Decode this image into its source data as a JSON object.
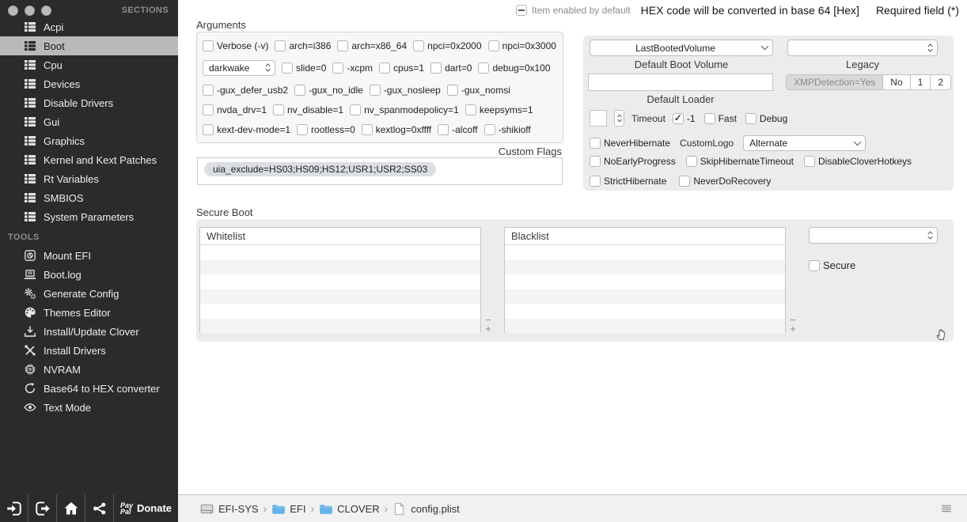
{
  "header": {
    "item_enabled_label": "Item enabled by default",
    "hex_note": "HEX code will be converted in base 64 [Hex]",
    "required_note": "Required field (*)"
  },
  "sidebar": {
    "sections_title": "SECTIONS",
    "tools_title": "TOOLS",
    "sections": [
      {
        "label": "Acpi"
      },
      {
        "label": "Boot",
        "selected": true
      },
      {
        "label": "Cpu"
      },
      {
        "label": "Devices"
      },
      {
        "label": "Disable Drivers"
      },
      {
        "label": "Gui"
      },
      {
        "label": "Graphics"
      },
      {
        "label": "Kernel and Kext Patches"
      },
      {
        "label": "Rt Variables"
      },
      {
        "label": "SMBIOS"
      },
      {
        "label": "System Parameters"
      }
    ],
    "tools": [
      {
        "label": "Mount EFI",
        "icon": "mount-efi-icon"
      },
      {
        "label": "Boot.log",
        "icon": "bootlog-icon"
      },
      {
        "label": "Generate Config",
        "icon": "gears-icon"
      },
      {
        "label": "Themes Editor",
        "icon": "palette-icon"
      },
      {
        "label": "Install/Update Clover",
        "icon": "download-icon"
      },
      {
        "label": "Install Drivers",
        "icon": "tools-icon"
      },
      {
        "label": "NVRAM",
        "icon": "chip-icon"
      },
      {
        "label": "Base64 to HEX converter",
        "icon": "refresh-icon"
      },
      {
        "label": "Text Mode",
        "icon": "eye-icon"
      }
    ]
  },
  "arguments": {
    "title": "Arguments",
    "rows": [
      [
        {
          "t": "check",
          "label": "Verbose (-v)"
        },
        {
          "t": "check",
          "label": "arch=i386"
        },
        {
          "t": "check",
          "label": "arch=x86_64"
        },
        {
          "t": "check",
          "label": "npci=0x2000"
        },
        {
          "t": "check",
          "label": "npci=0x3000"
        }
      ],
      [
        {
          "t": "popup",
          "value": "darkwake"
        },
        {
          "t": "check",
          "label": "slide=0"
        },
        {
          "t": "check",
          "label": "-xcpm"
        },
        {
          "t": "check",
          "label": "cpus=1"
        },
        {
          "t": "check",
          "label": "dart=0"
        },
        {
          "t": "check",
          "label": "debug=0x100"
        }
      ],
      [
        {
          "t": "check",
          "label": "-gux_defer_usb2"
        },
        {
          "t": "check",
          "label": "-gux_no_idle"
        },
        {
          "t": "check",
          "label": "-gux_nosleep"
        },
        {
          "t": "check",
          "label": "-gux_nomsi"
        }
      ],
      [
        {
          "t": "check",
          "label": "nvda_drv=1"
        },
        {
          "t": "check",
          "label": "nv_disable=1"
        },
        {
          "t": "check",
          "label": "nv_spanmodepolicy=1"
        },
        {
          "t": "check",
          "label": "keepsyms=1"
        }
      ],
      [
        {
          "t": "check",
          "label": "kext-dev-mode=1"
        },
        {
          "t": "check",
          "label": "rootless=0"
        },
        {
          "t": "check",
          "label": "kextlog=0xffff"
        },
        {
          "t": "check",
          "label": "-alcoff"
        },
        {
          "t": "check",
          "label": "-shikioff"
        }
      ]
    ],
    "custom_flags_label": "Custom Flags",
    "custom_flags_token": "uia_exclude=HS03;HS09;HS12;USR1;USR2;SS03"
  },
  "boot": {
    "default_boot_volume_value": "LastBootedVolume",
    "default_boot_volume_label": "Default Boot Volume",
    "legacy_value": "",
    "legacy_label": "Legacy",
    "default_loader_value": "",
    "default_loader_label": "Default Loader",
    "xmp_segments": [
      "XMPDetection=Yes",
      "No",
      "1",
      "2"
    ],
    "timeout_value": "",
    "timeout_label": "Timeout",
    "timeout_checks": [
      {
        "label": "-1",
        "checked": true
      },
      {
        "label": "Fast"
      },
      {
        "label": "Debug"
      }
    ],
    "never_hibernate_label": "NeverHibernate",
    "custom_logo_label": "CustomLogo",
    "custom_logo_value": "Alternate",
    "row3_checks": [
      {
        "label": "NoEarlyProgress"
      },
      {
        "label": "SkipHibernateTimeout"
      },
      {
        "label": "DisableCloverHotkeys"
      }
    ],
    "row4_checks": [
      {
        "label": "StrictHibernate"
      },
      {
        "label": "NeverDoRecovery"
      }
    ]
  },
  "secure_boot": {
    "title": "Secure Boot",
    "whitelist_header": "Whitelist",
    "blacklist_header": "Blacklist",
    "secure_label": "Secure",
    "add_label": "+",
    "remove_label": "−"
  },
  "footer": {
    "paypal_line1": "Pay",
    "paypal_line2": "Pal",
    "donate_label": "Donate",
    "separator": "›",
    "breadcrumb": [
      {
        "icon": "disk-icon",
        "label": "EFI-SYS"
      },
      {
        "icon": "folder-icon",
        "label": "EFI"
      },
      {
        "icon": "folder-icon",
        "label": "CLOVER"
      },
      {
        "icon": "file-icon",
        "label": "config.plist"
      }
    ]
  },
  "colors": {
    "sidebar_bg": "#2b2b2b",
    "selected_row": "#b9b9b9",
    "panel_bg": "#ececec",
    "folder_blue": "#66b3e8"
  }
}
